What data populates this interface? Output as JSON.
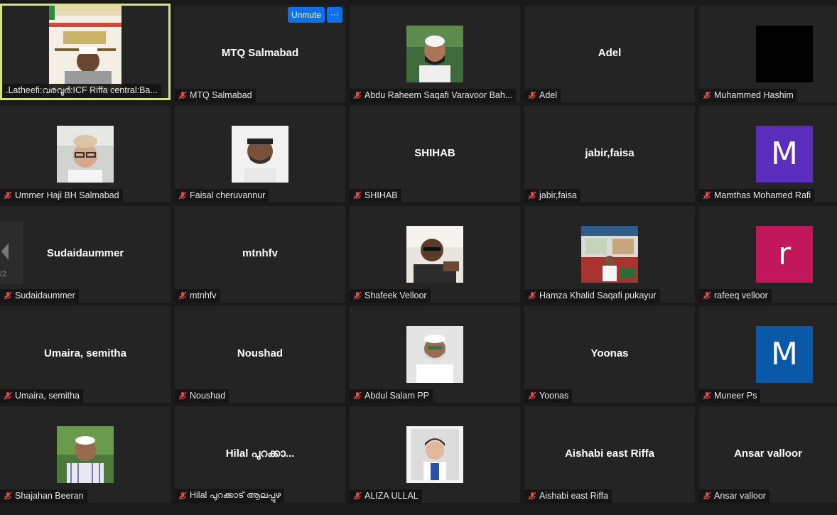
{
  "controls": {
    "unmute_label": "Unmute",
    "more_label": "···"
  },
  "pager": {
    "page": "/2"
  },
  "participants": [
    {
      "id": "p1",
      "label": ".Latheefi:വരവൂർ:ICF Riffa central:Ba...",
      "center": "",
      "kind": "video"
    },
    {
      "id": "p2",
      "label": "MTQ Salmabad",
      "center": "MTQ Salmabad",
      "kind": "name"
    },
    {
      "id": "p3",
      "label": "Abdu Raheem Saqafi Varavoor Bah...",
      "center": "",
      "kind": "photo"
    },
    {
      "id": "p4",
      "label": "Adel",
      "center": "Adel",
      "kind": "name"
    },
    {
      "id": "p5",
      "label": "Muhammed Hashim",
      "center": "",
      "kind": "black"
    },
    {
      "id": "p6",
      "label": "Ummer Haji BH Salmabad",
      "center": "",
      "kind": "photo"
    },
    {
      "id": "p7",
      "label": "Faisal cheruvannur",
      "center": "",
      "kind": "photo"
    },
    {
      "id": "p8",
      "label": "SHIHAB",
      "center": "SHIHAB",
      "kind": "name"
    },
    {
      "id": "p9",
      "label": "jabir,faisa",
      "center": "jabir,faisa",
      "kind": "name"
    },
    {
      "id": "p10",
      "label": "Mamthas Mohamed Rafi",
      "center": "M",
      "kind": "letter",
      "color": "#5b2dbd"
    },
    {
      "id": "p11",
      "label": "Sudaidaummer",
      "center": "Sudaidaummer",
      "kind": "name"
    },
    {
      "id": "p12",
      "label": "mtnhfv",
      "center": "mtnhfv",
      "kind": "name"
    },
    {
      "id": "p13",
      "label": "Shafeek Velloor",
      "center": "",
      "kind": "photo"
    },
    {
      "id": "p14",
      "label": "Hamza Khalid Saqafi pukayur",
      "center": "",
      "kind": "photo"
    },
    {
      "id": "p15",
      "label": "rafeeq velloor",
      "center": "r",
      "kind": "letter",
      "color": "#c2185b"
    },
    {
      "id": "p16",
      "label": "Umaira, semitha",
      "center": "Umaira, semitha",
      "kind": "name"
    },
    {
      "id": "p17",
      "label": "Noushad",
      "center": "Noushad",
      "kind": "name"
    },
    {
      "id": "p18",
      "label": "Abdul Salam PP",
      "center": "",
      "kind": "photo"
    },
    {
      "id": "p19",
      "label": "Yoonas",
      "center": "Yoonas",
      "kind": "name"
    },
    {
      "id": "p20",
      "label": "Muneer Ps",
      "center": "M",
      "kind": "letter",
      "color": "#0a58a8"
    },
    {
      "id": "p21",
      "label": "Shajahan Beeran",
      "center": "",
      "kind": "photo"
    },
    {
      "id": "p22",
      "label": "Hilal പുറക്കാട് ആലപ്പുഴ",
      "center": "Hilal പുറക്കാ...",
      "kind": "name"
    },
    {
      "id": "p23",
      "label": "ALIZA ULLAL",
      "center": "",
      "kind": "photo"
    },
    {
      "id": "p24",
      "label": "Aishabi east Riffa",
      "center": "Aishabi east Riffa",
      "kind": "name"
    },
    {
      "id": "p25",
      "label": "Ansar valloor",
      "center": "Ansar valloor",
      "kind": "name"
    }
  ]
}
